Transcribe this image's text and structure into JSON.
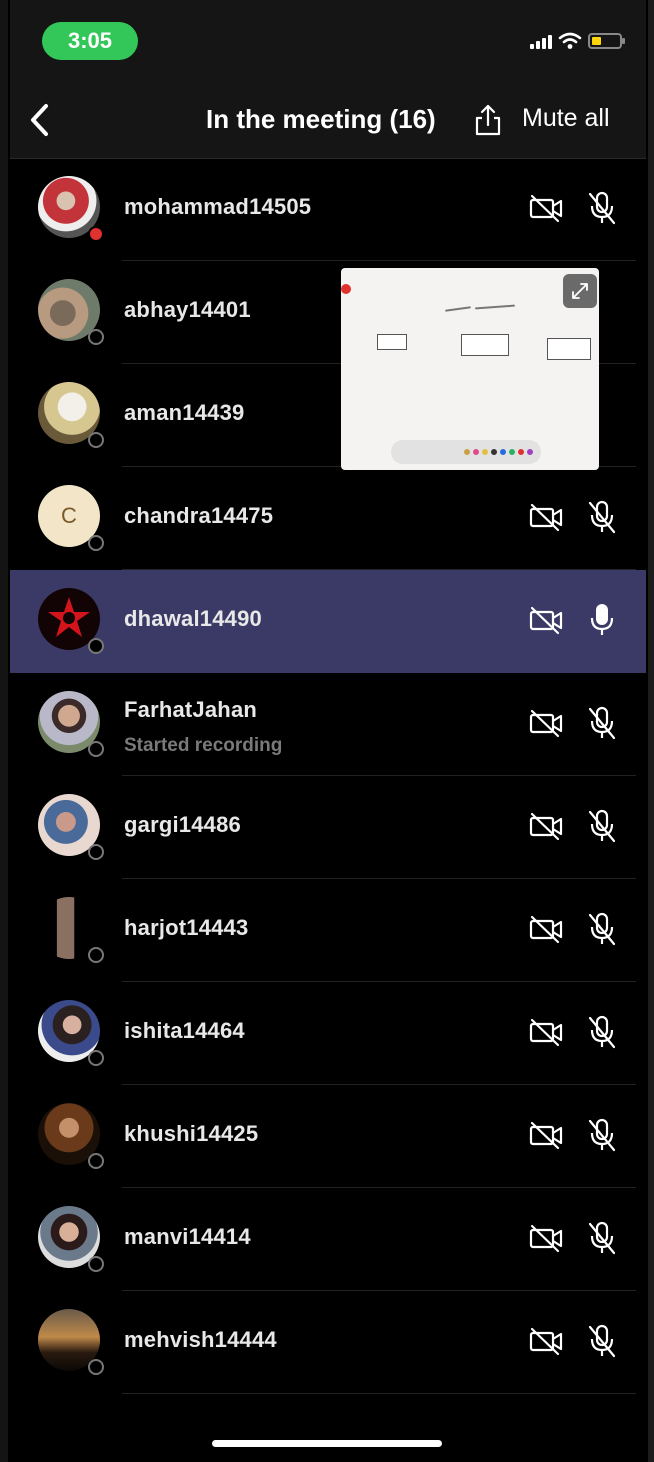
{
  "status_bar": {
    "time": "3:05",
    "time_pill_color": "#33c759",
    "icons": [
      "signal-icon",
      "wifi-icon",
      "battery-icon"
    ],
    "battery_level": 0.25,
    "battery_color": "#ffd60a"
  },
  "header": {
    "title": "In the meeting (16)",
    "back_icon": "chevron-left-icon",
    "share_icon": "share-icon",
    "mute_all_label": "Mute all"
  },
  "participants": [
    {
      "name": "mohammad14505",
      "subtext": "",
      "camera": "off",
      "mic": "muted",
      "status_dot": "red"
    },
    {
      "name": "abhay14401",
      "subtext": "",
      "camera": "hidden",
      "mic": "hidden",
      "status_dot": "gray"
    },
    {
      "name": "aman14439",
      "subtext": "",
      "camera": "hidden",
      "mic": "hidden",
      "status_dot": "gray"
    },
    {
      "name": "chandra14475",
      "subtext": "",
      "camera": "off",
      "mic": "muted",
      "status_dot": "gray",
      "initial": "C"
    },
    {
      "name": "dhawal14490",
      "subtext": "",
      "camera": "off",
      "mic": "on",
      "status_dot": "gray",
      "highlighted": true
    },
    {
      "name": "FarhatJahan",
      "subtext": "Started recording",
      "camera": "off",
      "mic": "muted",
      "status_dot": "gray"
    },
    {
      "name": "gargi14486",
      "subtext": "",
      "camera": "off",
      "mic": "muted",
      "status_dot": "gray"
    },
    {
      "name": "harjot14443",
      "subtext": "",
      "camera": "off",
      "mic": "muted",
      "status_dot": "gray"
    },
    {
      "name": "ishita14464",
      "subtext": "",
      "camera": "off",
      "mic": "muted",
      "status_dot": "gray"
    },
    {
      "name": "khushi14425",
      "subtext": "",
      "camera": "off",
      "mic": "muted",
      "status_dot": "gray"
    },
    {
      "name": "manvi14414",
      "subtext": "",
      "camera": "off",
      "mic": "muted",
      "status_dot": "gray"
    },
    {
      "name": "mehvish14444",
      "subtext": "",
      "camera": "off",
      "mic": "muted",
      "status_dot": "gray"
    }
  ],
  "highlight_color": "#3b3a66",
  "floating_preview": {
    "content": "whiteboard-screen-share",
    "expand_icon": "expand-icon"
  }
}
